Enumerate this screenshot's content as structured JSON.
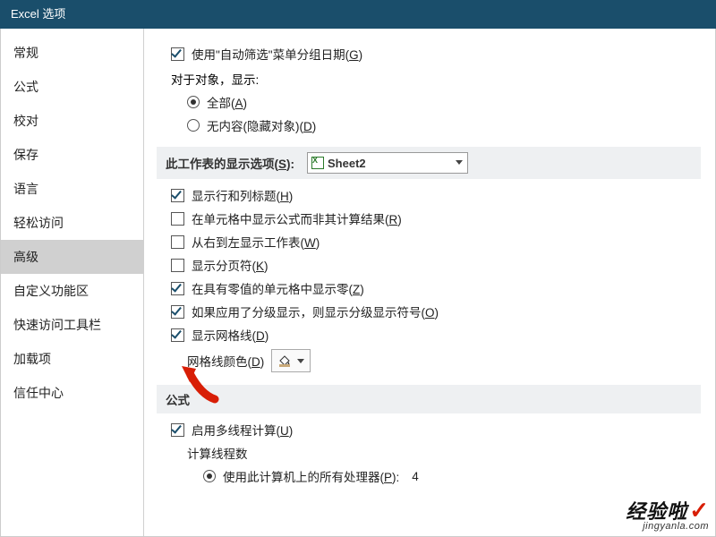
{
  "title": "Excel 选项",
  "sidebar": {
    "items": [
      {
        "label": "常规"
      },
      {
        "label": "公式"
      },
      {
        "label": "校对"
      },
      {
        "label": "保存"
      },
      {
        "label": "语言"
      },
      {
        "label": "轻松访问"
      },
      {
        "label": "高级"
      },
      {
        "label": "自定义功能区"
      },
      {
        "label": "快速访问工具栏"
      },
      {
        "label": "加载项"
      },
      {
        "label": "信任中心"
      }
    ],
    "selected_index": 6
  },
  "opts": {
    "autofilter_group": "使用\"自动筛选\"菜单分组日期(G)",
    "objects_label": "对于对象，显示:",
    "objects_all": "全部(A)",
    "objects_none": "无内容(隐藏对象)(D)",
    "sheet_section": "此工作表的显示选项(S):",
    "sheet_selected": "Sheet2",
    "row_col_headers": "显示行和列标题(H)",
    "show_formulas": "在单元格中显示公式而非其计算结果(R)",
    "rtl": "从右到左显示工作表(W)",
    "page_breaks": "显示分页符(K)",
    "zero_values": "在具有零值的单元格中显示零(Z)",
    "outline": "如果应用了分级显示，则显示分级显示符号(O)",
    "gridlines": "显示网格线(D)",
    "grid_color": "网格线颜色(D)",
    "formula_section": "公式",
    "multithread": "启用多线程计算(U)",
    "thread_count_label": "计算线程数",
    "use_all_cpu": "使用此计算机上的所有处理器(P):",
    "cpu_count": "4"
  },
  "watermark": {
    "line1": "经验啦",
    "check": "✓",
    "line2": "jingyanla.com"
  }
}
